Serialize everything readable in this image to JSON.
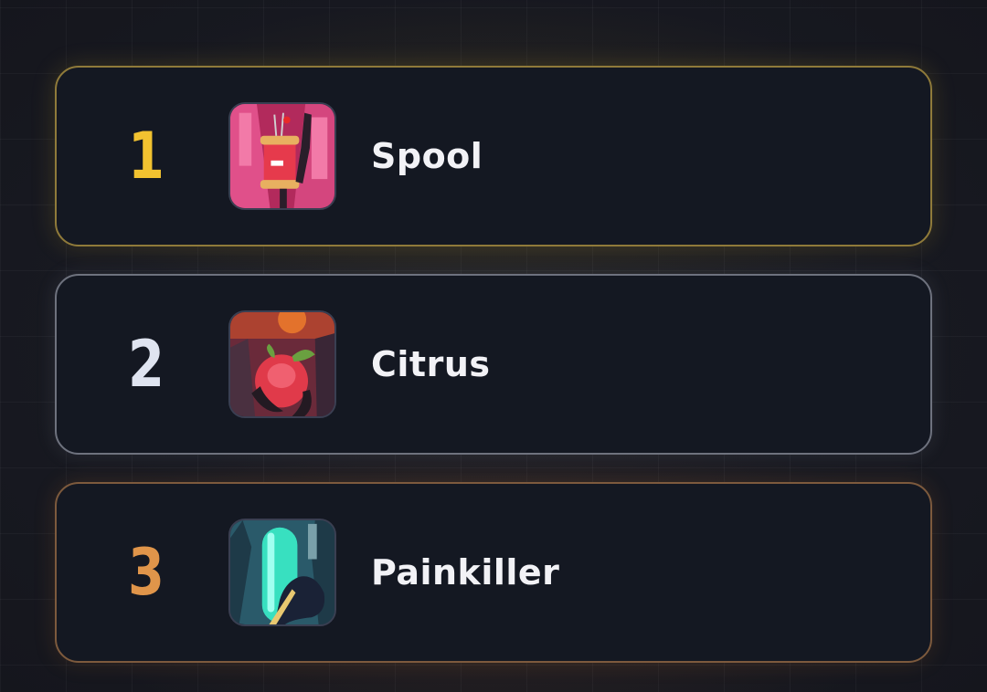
{
  "leaderboard": {
    "entries": [
      {
        "rank": "1",
        "name": "Spool",
        "tier": "gold",
        "rank_color": "#f2c230",
        "cover_icon": "spool-game-cover-icon"
      },
      {
        "rank": "2",
        "name": "Citrus",
        "tier": "silver",
        "rank_color": "#dfe4f0",
        "cover_icon": "citrus-game-cover-icon"
      },
      {
        "rank": "3",
        "name": "Painkiller",
        "tier": "bronze",
        "rank_color": "#e0954a",
        "cover_icon": "painkiller-game-cover-icon"
      }
    ]
  },
  "colors": {
    "background": "#181a22",
    "card_background": "#141822",
    "gold_border": "#8f7a3a",
    "silver_border": "#6e727e",
    "bronze_border": "#7d5a3d",
    "name_text": "#f2f2f6"
  }
}
